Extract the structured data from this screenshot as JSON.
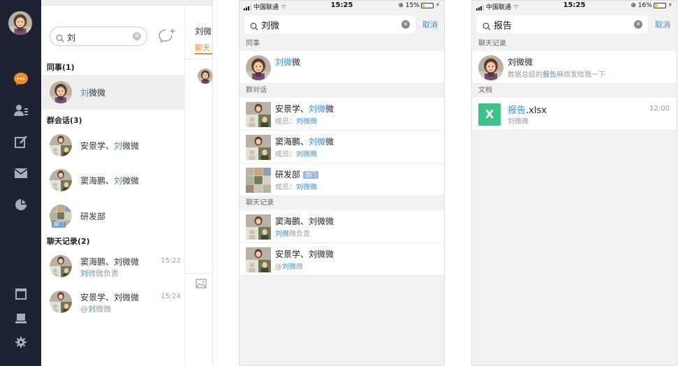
{
  "desktop": {
    "search_value": "刘",
    "contacts_header": "同事(1)",
    "contacts": [
      {
        "pre": "",
        "hl": "刘",
        "post": "微微"
      }
    ],
    "groups_header": "群会话(3)",
    "groups": [
      {
        "pre": "安景学、",
        "hl": "刘",
        "post": "微微"
      },
      {
        "pre": "窦海鹏、",
        "hl": "刘",
        "post": "微微"
      },
      {
        "pre": "研发部",
        "hl": "",
        "post": "",
        "badge": "部门"
      }
    ],
    "history_header": "聊天记录(2)",
    "history": [
      {
        "title": "窦海鹏、刘微微",
        "sub_pre": "",
        "sub_hl": "刘",
        "sub_post": "微微负责",
        "time": "15:22"
      },
      {
        "title": "安景学、刘微微",
        "sub_pre": "@",
        "sub_hl": "刘",
        "sub_post": "微微",
        "time": "15:24"
      }
    ],
    "right_title": "刘微",
    "right_tab": "聊天"
  },
  "phone1": {
    "carrier": "中国联通",
    "time": "15:25",
    "battery": "15%",
    "search_value": "刘微",
    "cancel": "取消",
    "sec_colleague": "同事",
    "colleague": {
      "hl": "刘微",
      "post": "微"
    },
    "sec_group": "群对话",
    "groups": [
      {
        "pre": "安景学、",
        "hl": "刘微",
        "post": "微",
        "member_label": "成员：",
        "member": "刘微微"
      },
      {
        "pre": "窦海鹏、",
        "hl": "刘微",
        "post": "微",
        "member_label": "成员：",
        "member": "刘微微"
      },
      {
        "pre": "研发部",
        "hl": "",
        "post": "",
        "badge": "部门",
        "member_label": "成员：",
        "member": "刘微微"
      }
    ],
    "sec_history": "聊天记录",
    "history": [
      {
        "title": "窦海鹏、刘微微",
        "sub_pre": "",
        "sub_hl": "刘微",
        "sub_post": "微负责"
      },
      {
        "title": "安景学、刘微微",
        "sub_pre": "@",
        "sub_hl": "刘微",
        "sub_post": "微"
      }
    ]
  },
  "phone2": {
    "carrier": "中国联通",
    "time": "15:25",
    "battery": "16%",
    "search_value": "报告",
    "cancel": "取消",
    "sec_history": "聊天记录",
    "history": {
      "title": "刘微微",
      "sub_pre": "数据总结的",
      "sub_hl": "报告",
      "sub_post": "麻烦发给我一下"
    },
    "sec_docs": "文档",
    "doc": {
      "hl": "报告",
      "post": ".xlsx",
      "owner": "刘微微",
      "time": "12:00",
      "icon_letter": "X"
    }
  },
  "colors": {
    "highlight": "#3a8fd6",
    "rail": "#1f2233",
    "accent_orange": "#f08c2a",
    "xls_green": "#3fc28a"
  }
}
